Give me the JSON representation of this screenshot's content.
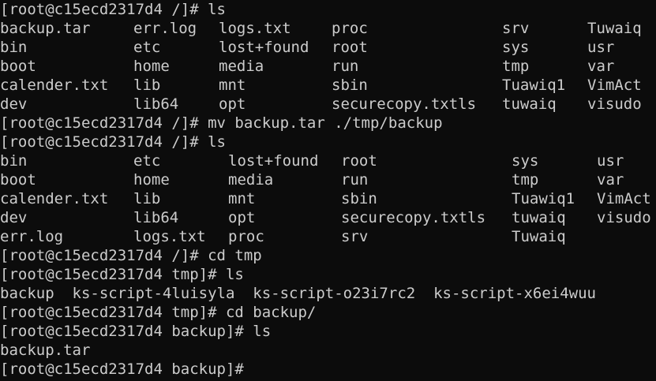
{
  "terminal": {
    "lines": [
      {
        "type": "prompt",
        "text": "[root@c15ecd2317d4 /]# ls"
      },
      {
        "type": "listing",
        "cells": [
          "backup.tar",
          "err.log",
          "logs.txt",
          "proc",
          "srv",
          "Tuwaiq"
        ]
      },
      {
        "type": "listing",
        "cells": [
          "bin",
          "etc",
          "lost+found",
          "root",
          "sys",
          "usr"
        ]
      },
      {
        "type": "listing",
        "cells": [
          "boot",
          "home",
          "media",
          "run",
          "tmp",
          "var"
        ]
      },
      {
        "type": "listing",
        "cells": [
          "calender.txt",
          "lib",
          "mnt",
          "sbin",
          "Tuawiq1",
          "VimAct"
        ]
      },
      {
        "type": "listing",
        "cells": [
          "dev",
          "lib64",
          "opt",
          "securecopy.txtls",
          "tuwaiq",
          "visudo"
        ]
      },
      {
        "type": "prompt",
        "text": "[root@c15ecd2317d4 /]# mv backup.tar ./tmp/backup"
      },
      {
        "type": "prompt",
        "text": "[root@c15ecd2317d4 /]# ls"
      },
      {
        "type": "listing2",
        "cells": [
          "bin",
          "etc",
          "lost+found",
          "root",
          "sys",
          "usr"
        ]
      },
      {
        "type": "listing2",
        "cells": [
          "boot",
          "home",
          "media",
          "run",
          "tmp",
          "var"
        ]
      },
      {
        "type": "listing2",
        "cells": [
          "calender.txt",
          "lib",
          "mnt",
          "sbin",
          "Tuawiq1",
          "VimAct"
        ]
      },
      {
        "type": "listing2",
        "cells": [
          "dev",
          "lib64",
          "opt",
          "securecopy.txtls",
          "tuwaiq",
          "visudo"
        ]
      },
      {
        "type": "listing2",
        "cells": [
          "err.log",
          "logs.txt",
          "proc",
          "srv",
          "Tuwaiq",
          ""
        ]
      },
      {
        "type": "prompt",
        "text": "[root@c15ecd2317d4 /]# cd tmp"
      },
      {
        "type": "prompt",
        "text": "[root@c15ecd2317d4 tmp]# ls"
      },
      {
        "type": "text",
        "text": "backup  ks-script-4luisyla  ks-script-o23i7rc2  ks-script-x6ei4wuu"
      },
      {
        "type": "prompt",
        "text": "[root@c15ecd2317d4 tmp]# cd backup/"
      },
      {
        "type": "prompt",
        "text": "[root@c15ecd2317d4 backup]# ls"
      },
      {
        "type": "text",
        "text": "backup.tar"
      },
      {
        "type": "prompt",
        "text": "[root@c15ecd2317d4 backup]#"
      }
    ]
  }
}
